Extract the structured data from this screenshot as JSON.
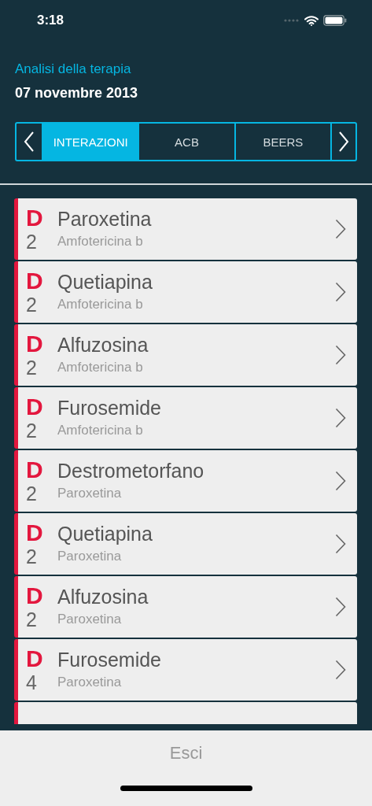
{
  "status_bar": {
    "time": "3:18"
  },
  "header": {
    "title": "Analisi della terapia",
    "date": "07 novembre 2013"
  },
  "tabs": [
    {
      "label": "INTERAZIONI",
      "selected": true
    },
    {
      "label": "ACB",
      "selected": false
    },
    {
      "label": "BEERS",
      "selected": false
    }
  ],
  "interactions": [
    {
      "grade": "D",
      "level_number": "2",
      "drug": "Paroxetina",
      "with": "Amfotericina b"
    },
    {
      "grade": "D",
      "level_number": "2",
      "drug": "Quetiapina",
      "with": "Amfotericina b"
    },
    {
      "grade": "D",
      "level_number": "2",
      "drug": "Alfuzosina",
      "with": "Amfotericina b"
    },
    {
      "grade": "D",
      "level_number": "2",
      "drug": "Furosemide",
      "with": "Amfotericina b"
    },
    {
      "grade": "D",
      "level_number": "2",
      "drug": "Destrometorfano",
      "with": "Paroxetina"
    },
    {
      "grade": "D",
      "level_number": "2",
      "drug": "Quetiapina",
      "with": "Paroxetina"
    },
    {
      "grade": "D",
      "level_number": "2",
      "drug": "Alfuzosina",
      "with": "Paroxetina"
    },
    {
      "grade": "D",
      "level_number": "4",
      "drug": "Furosemide",
      "with": "Paroxetina"
    }
  ],
  "more_below": true,
  "footer": {
    "button": "Esci"
  }
}
